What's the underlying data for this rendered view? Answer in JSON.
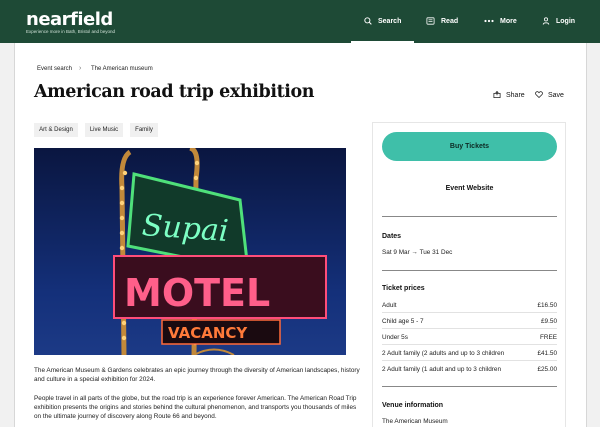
{
  "header": {
    "logo": "nearfield",
    "tagline": "Experience more in Bath, Bristol and beyond",
    "nav": [
      {
        "label": "Search",
        "icon": "search-icon"
      },
      {
        "label": "Read",
        "icon": "newspaper-icon"
      },
      {
        "label": "More",
        "icon": "more-dots-icon"
      },
      {
        "label": "Login",
        "icon": "user-icon"
      }
    ],
    "active_nav": "Search",
    "bar_color": "#1e4a36"
  },
  "breadcrumb": [
    "Event search",
    "The American museum"
  ],
  "page_title": "American road trip exhibition",
  "actions": {
    "share": "Share",
    "save": "Save"
  },
  "tags": [
    "Art & Design",
    "Live Music",
    "Family"
  ],
  "hero": {
    "sign_top": "Supai",
    "sign_middle": "MOTEL",
    "sign_bottom": "VACANCY"
  },
  "description": [
    "The American Museum & Gardens celebrates an epic journey through the diversity of American landscapes, history and culture in a special exhibition for 2024.",
    "People travel in all parts of the globe, but the road trip is an experience forever American. The American Road Trip exhibition presents the origins and stories behind the cultural phenomenon, and transports you thousands of miles on the ultimate journey of discovery along Route 66 and beyond."
  ],
  "sidebar": {
    "buy_label": "Buy Tickets",
    "button_color": "#3fbfa9",
    "website_label": "Event Website",
    "dates_title": "Dates",
    "date_from": "Sat 9 Mar",
    "date_to": "Tue 31 Dec",
    "prices_title": "Ticket prices",
    "prices": [
      {
        "label": "Adult",
        "price": "£16.50"
      },
      {
        "label": "Child age 5 - 7",
        "price": "£9.50"
      },
      {
        "label": "Under 5s",
        "price": "FREE"
      },
      {
        "label": "2 Adult family (2 adults and up to 3 children",
        "price": "£41.50"
      },
      {
        "label": "2 Adult family (1 adult and up to 3 children",
        "price": "£25.00"
      }
    ],
    "venue_title": "Venue information",
    "venue_name": "The American Museum"
  }
}
